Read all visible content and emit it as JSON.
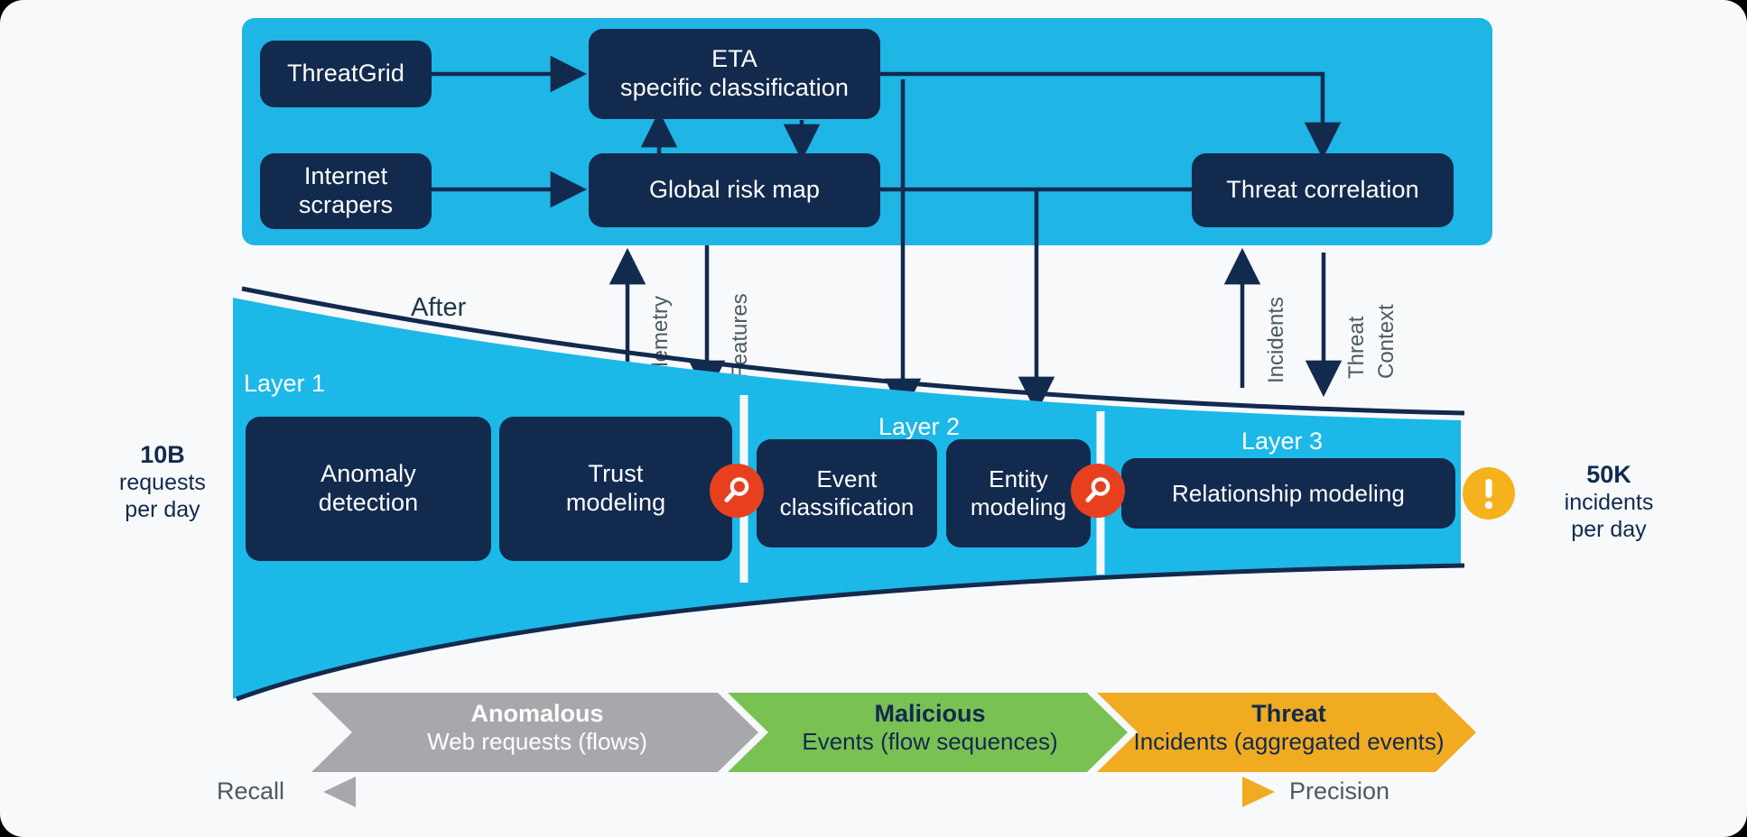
{
  "colors": {
    "panel_blue": "#1fb5e5",
    "funnel_blue": "#1cb8e8",
    "node_navy": "#122a4e",
    "outline_navy": "#132a4f",
    "chevron_gray": "#a6a8ab",
    "chevron_green": "#7ac153",
    "chevron_orange": "#f0ab21",
    "magnifier_red": "#e8401f",
    "warning_orange": "#f5b21c",
    "background": "#f7f9fa"
  },
  "top_panel": {
    "nodes": [
      {
        "id": "threatgrid",
        "label": "ThreatGrid"
      },
      {
        "id": "internet",
        "label": "Internet\nscrapers"
      },
      {
        "id": "eta",
        "label": "ETA\nspecific classification"
      },
      {
        "id": "globalrisk",
        "label": "Global risk map"
      },
      {
        "id": "threatcorr",
        "label": "Threat correlation"
      }
    ]
  },
  "flow_labels": {
    "telemetry": "Telemetry",
    "features": "Features",
    "incidents": "Incidents",
    "threat_context": "Threat\nContext"
  },
  "funnel": {
    "after_label": "After",
    "left_metric": {
      "value": "10B",
      "line1": "requests",
      "line2": "per day"
    },
    "right_metric": {
      "value": "50K",
      "line1": "incidents",
      "line2": "per day"
    },
    "layers": [
      {
        "tag": "Layer 1",
        "boxes": [
          "Anomaly\ndetection",
          "Trust\nmodeling"
        ]
      },
      {
        "tag": "Layer 2",
        "boxes": [
          "Event\nclassification",
          "Entity\nmodeling"
        ]
      },
      {
        "tag": "Layer 3",
        "boxes": [
          "Relationship modeling"
        ]
      }
    ]
  },
  "chevrons": [
    {
      "title": "Anomalous",
      "subtitle": "Web requests (flows)",
      "fill": "#a6a8ab",
      "text": "#ffffff"
    },
    {
      "title": "Malicious",
      "subtitle": "Events (flow sequences)",
      "fill": "#7ac153",
      "text": "#122a4e"
    },
    {
      "title": "Threat",
      "subtitle": "Incidents (aggregated events)",
      "fill": "#f0ab21",
      "text": "#122a4e"
    }
  ],
  "axis": {
    "left": "Recall",
    "right": "Precision"
  },
  "icons": {
    "magnifier": "magnifier-icon",
    "warning": "warning-icon"
  }
}
